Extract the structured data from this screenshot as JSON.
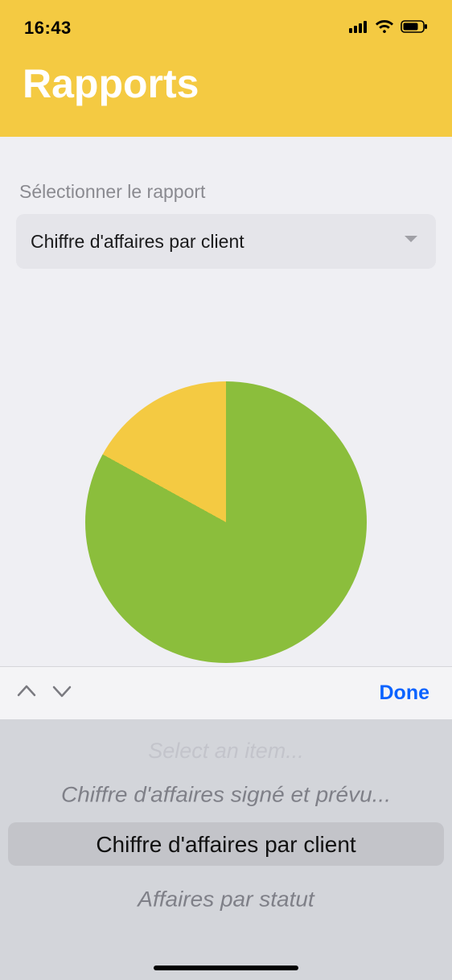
{
  "status": {
    "time": "16:43"
  },
  "header": {
    "title": "Rapports"
  },
  "report_select": {
    "label": "Sélectionner le rapport",
    "value": "Chiffre d'affaires par client"
  },
  "chart_data": {
    "type": "pie",
    "title": "",
    "series": [
      {
        "name": "slice-green",
        "value": 83,
        "color": "#8BBE3C"
      },
      {
        "name": "slice-yellow",
        "value": 17,
        "color": "#F4CA42"
      }
    ]
  },
  "picker_toolbar": {
    "done": "Done"
  },
  "picker": {
    "ghost": "Select an item...",
    "prev": "Chiffre d'affaires signé et prévu...",
    "selected": "Chiffre d'affaires par client",
    "next": "Affaires par statut"
  }
}
